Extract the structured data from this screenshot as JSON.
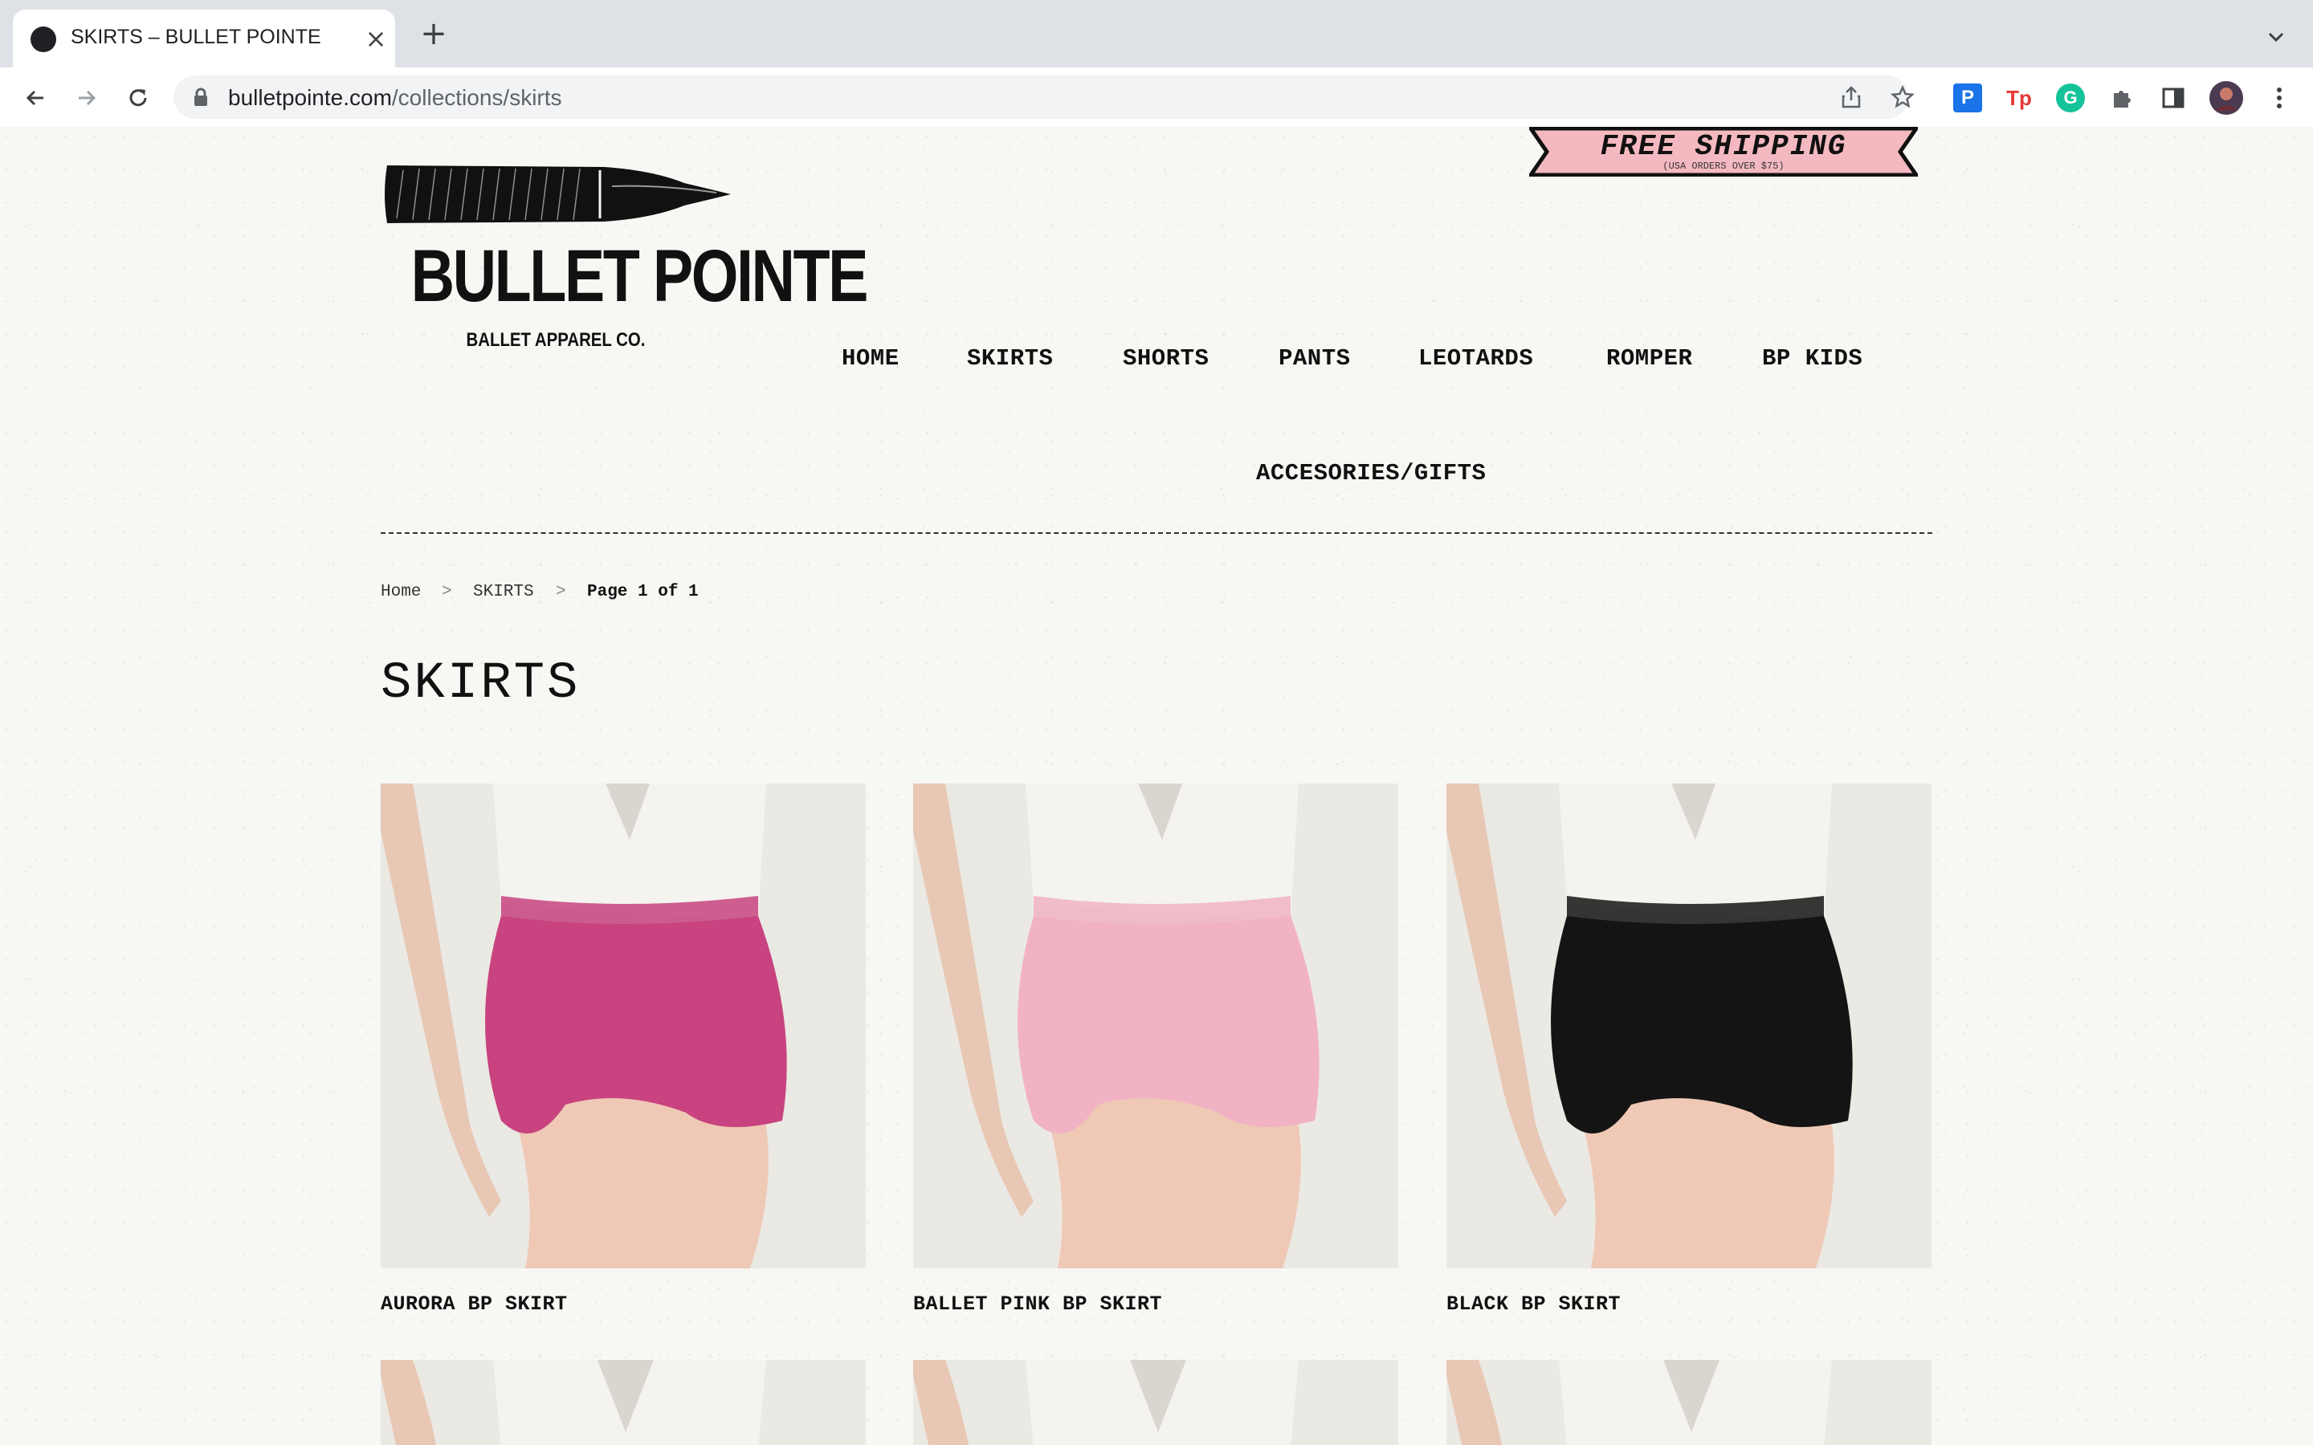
{
  "browser": {
    "tab_title": "SKIRTS – BULLET POINTE",
    "url_host": "bulletpointe.com",
    "url_path": "/collections/skirts",
    "extensions": [
      {
        "name": "pinterest-extension-icon",
        "glyph": "P",
        "color": "#1a73e8"
      },
      {
        "name": "tp-extension-icon",
        "glyph": "Tp",
        "color": "#e53935"
      },
      {
        "name": "grammarly-extension-icon",
        "glyph": "G",
        "color": "#15c39a"
      }
    ]
  },
  "site": {
    "logo_name": "BULLET POINTE",
    "logo_tagline": "BALLET APPAREL CO.",
    "banner_text": "FREE SHIPPING",
    "banner_sub": "(USA ORDERS OVER $75)",
    "nav": [
      "HOME",
      "SKIRTS",
      "SHORTS",
      "PANTS",
      "LEOTARDS",
      "ROMPER",
      "BP KIDS",
      "ACCESORIES/GIFTS"
    ]
  },
  "breadcrumb": {
    "home": "Home",
    "separator": ">",
    "section": "SKIRTS",
    "current": "Page 1 of 1"
  },
  "collection": {
    "title": "SKIRTS",
    "products": [
      {
        "name": "AURORA BP SKIRT",
        "color": "#c8437f"
      },
      {
        "name": "BALLET PINK BP SKIRT",
        "color": "#f1b3c4"
      },
      {
        "name": "BLACK BP SKIRT",
        "color": "#141414"
      }
    ]
  }
}
